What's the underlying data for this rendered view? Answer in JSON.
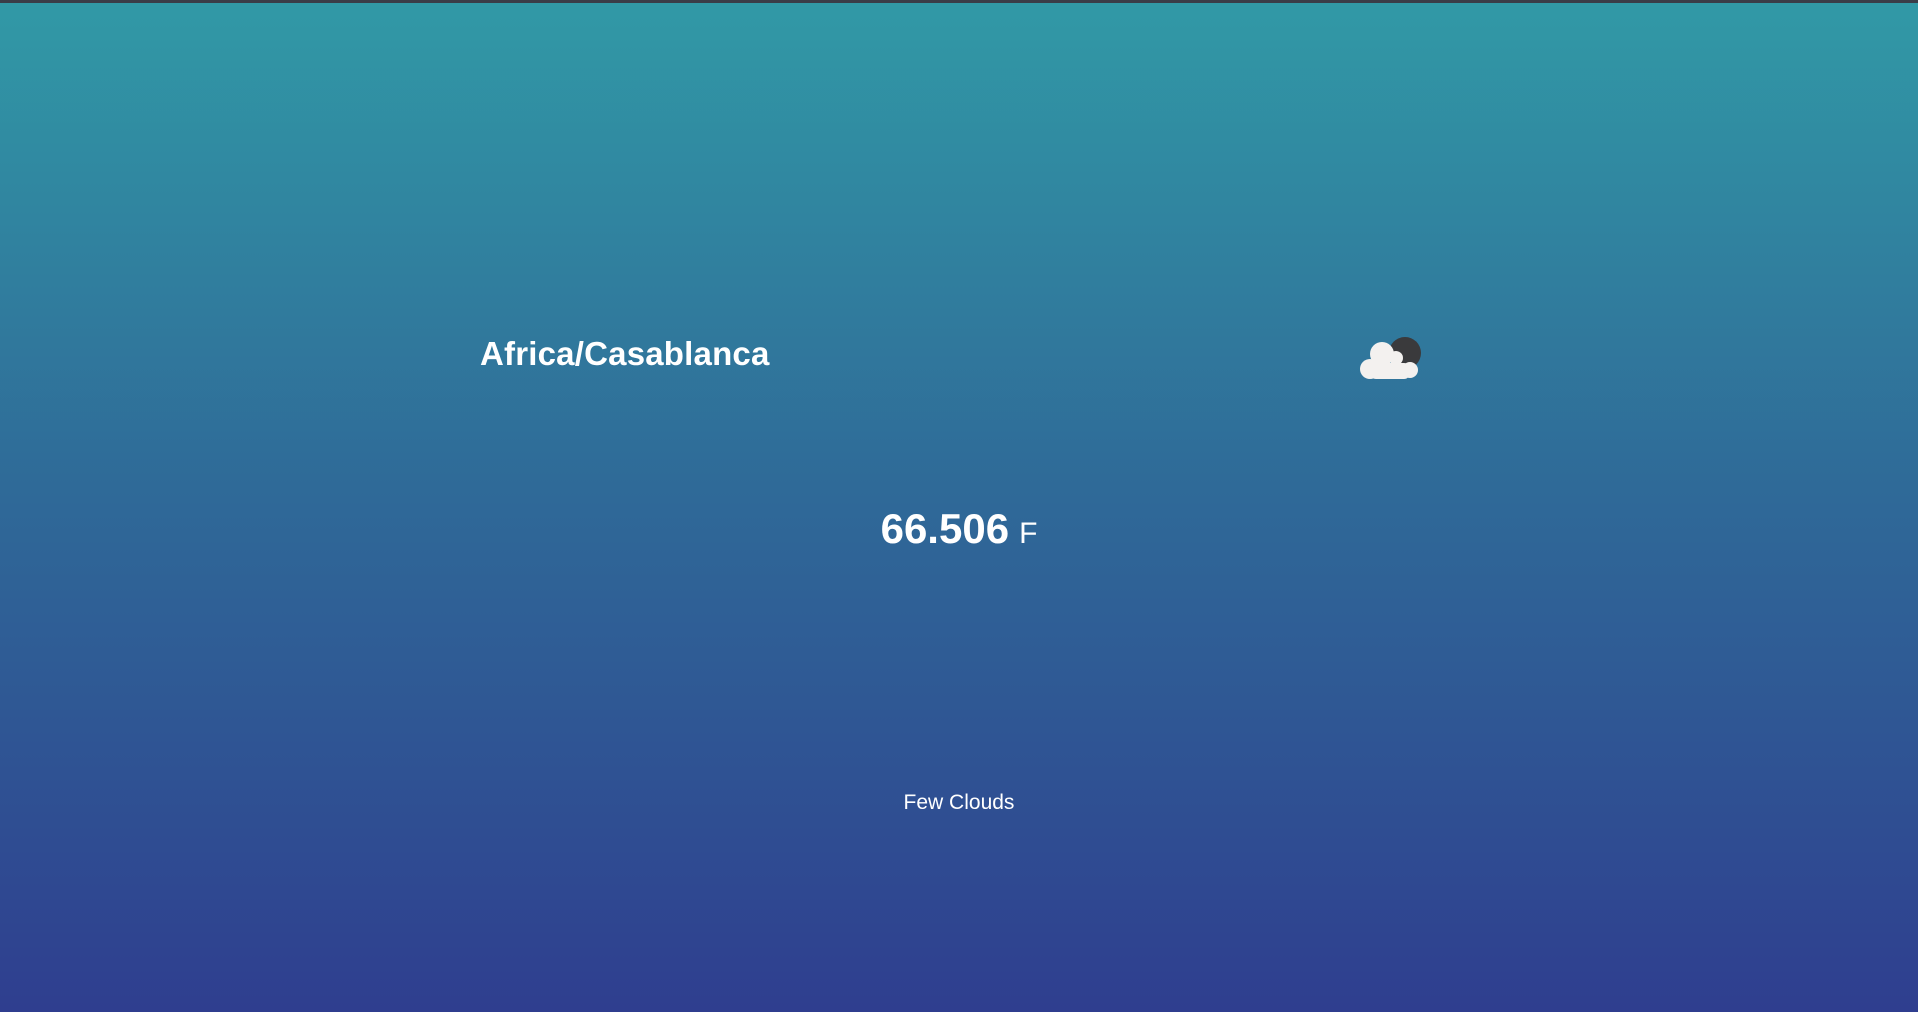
{
  "location": {
    "timezone": "Africa/Casablanca"
  },
  "weather": {
    "icon": "partly-cloudy-night-icon",
    "temperature": "66.506",
    "unit": "F",
    "summary": "Few Clouds"
  },
  "colors": {
    "gradient_top": "#3199a6",
    "gradient_middle": "#2f6a98",
    "gradient_bottom": "#2f3e8f",
    "text": "#ffffff",
    "moon": "#3a3a3c",
    "cloud": "#f3f1ef"
  }
}
